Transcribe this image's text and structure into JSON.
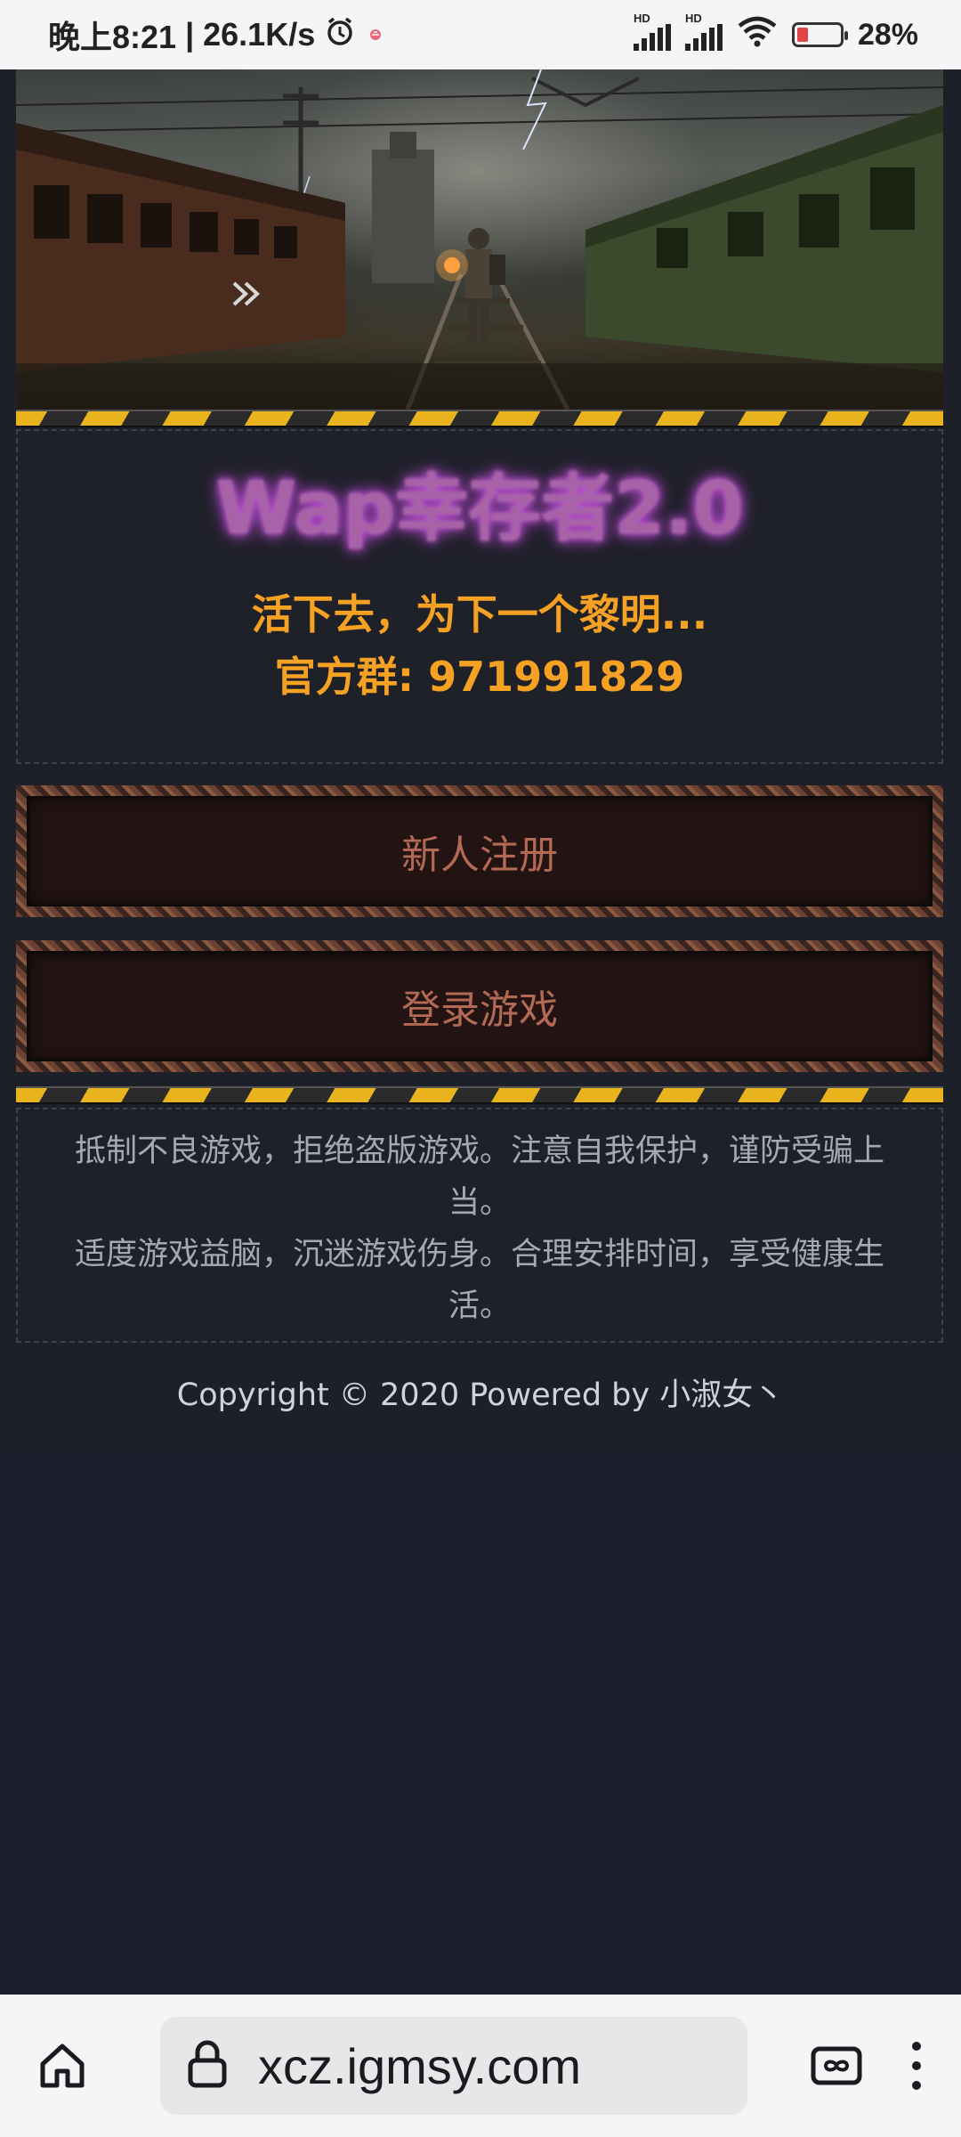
{
  "status_bar": {
    "time": "晚上8:21",
    "speed": "26.1K/s",
    "battery": "28%",
    "hd_label": "HD",
    "icons": [
      "alarm-icon",
      "notification-icon",
      "signal-icon",
      "wifi-icon",
      "battery-icon"
    ]
  },
  "game": {
    "title": "Wap幸存者2.0",
    "slogan": "活下去，为下一个黎明...",
    "group": "官方群: 971991829",
    "register_label": "新人注册",
    "login_label": "登录游戏",
    "notice_line1": "抵制不良游戏，拒绝盗版游戏。注意自我保护，谨防受骗上当。",
    "notice_line2": "适度游戏益脑，沉迷游戏伤身。合理安排时间，享受健康生活。",
    "copyright": "Copyright © 2020 Powered by 小淑女丶"
  },
  "browser": {
    "url": "xcz.igmsy.com",
    "icons": [
      "home-icon",
      "lock-icon",
      "tabs-icon",
      "more-icon"
    ]
  },
  "colors": {
    "accent_orange": "#f5a123",
    "title_purple": "#a863a8",
    "button_text": "#b36a55",
    "page_bg": "#1e2029",
    "hazard_yellow": "#e8b31c"
  }
}
